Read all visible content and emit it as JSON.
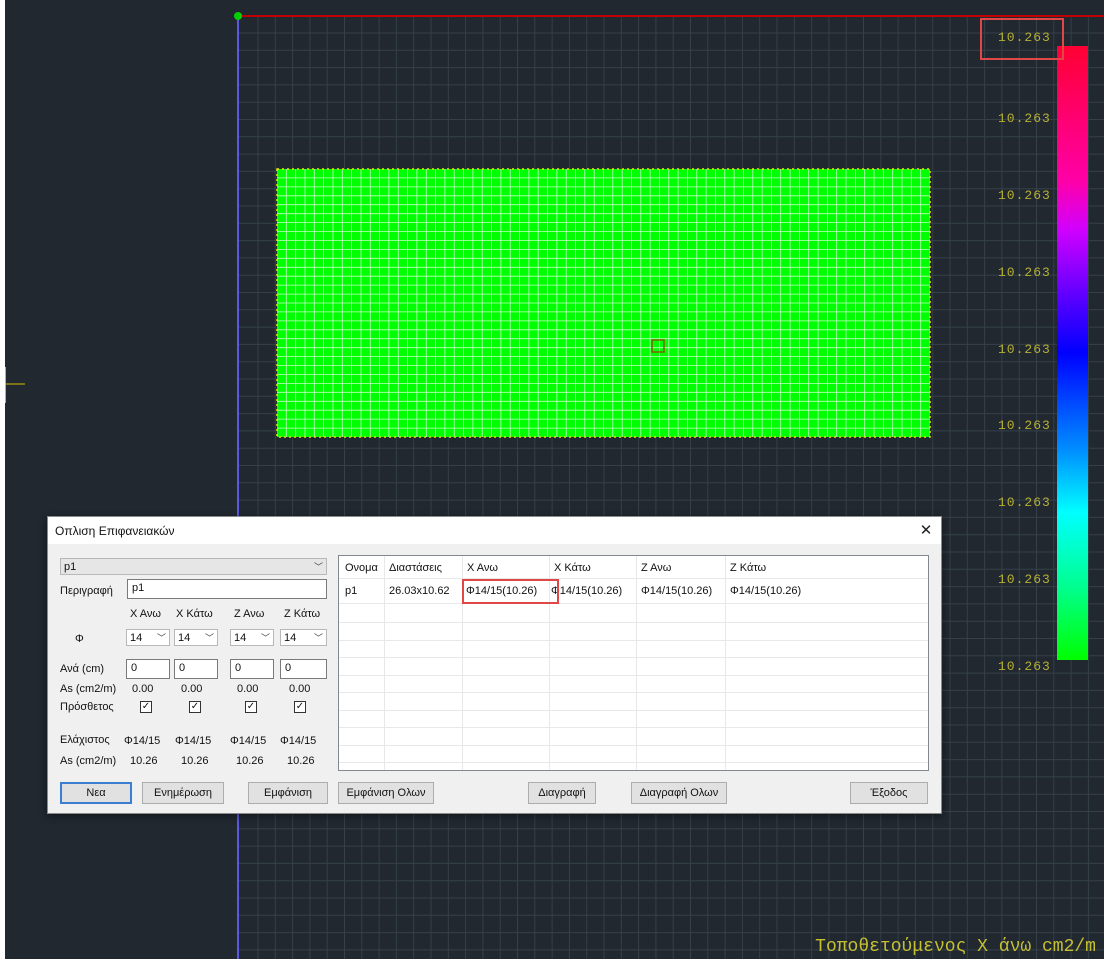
{
  "cad": {
    "legend_values": [
      "10.263",
      "10.263",
      "10.263",
      "10.263",
      "10.263",
      "10.263",
      "10.263",
      "10.263",
      "10.263"
    ],
    "caption": "Τοποθετούμενος Χ άνω cm2/m",
    "colors": {
      "background": "#212830",
      "grid": "#354049",
      "slab": "#00ff00",
      "axis_y": "#5a5ae0",
      "axis_x": "#c00000",
      "label": "#b6b032"
    }
  },
  "dialog": {
    "title": "Οπλιση Επιφανειακών",
    "close": "✕",
    "surface_select": "p1",
    "description_label": "Περιγραφή",
    "description_value": "p1",
    "col_headers": [
      "Χ Ανω",
      "Χ Κάτω",
      "Ζ Ανω",
      "Ζ Κάτω"
    ],
    "phi_label": "Φ",
    "phi_values": [
      "14",
      "14",
      "14",
      "14"
    ],
    "spacing_label": "Ανά (cm)",
    "spacing_values": [
      "0",
      "0",
      "0",
      "0"
    ],
    "as_label": "As (cm2/m)",
    "as_values": [
      "0.00",
      "0.00",
      "0.00",
      "0.00"
    ],
    "additional_label": "Πρόσθετος",
    "additional_checked": [
      true,
      true,
      true,
      true
    ],
    "minimum_label": "Ελάχιστος",
    "minimum_values": [
      "Φ14/15",
      "Φ14/15",
      "Φ14/15",
      "Φ14/15"
    ],
    "as2_label": "As (cm2/m)",
    "as2_values": [
      "10.26",
      "10.26",
      "10.26",
      "10.26"
    ],
    "table": {
      "headers": [
        "Ονομα",
        "Διαστάσεις",
        "Χ Ανω",
        "Χ Κάτω",
        "Ζ Ανω",
        "Ζ Κάτω"
      ],
      "rows": [
        [
          "p1",
          "26.03x10.62",
          "Φ14/15(10.26)",
          "Φ14/15(10.26)",
          "Φ14/15(10.26)",
          "Φ14/15(10.26)"
        ]
      ]
    },
    "buttons": {
      "new": "Νεα",
      "update": "Ενημέρωση",
      "show": "Εμφάνιση",
      "show_all": "Εμφάνιση Ολων",
      "delete": "Διαγραφή",
      "delete_all": "Διαγραφή Ολων",
      "exit": "Έξοδος"
    }
  }
}
